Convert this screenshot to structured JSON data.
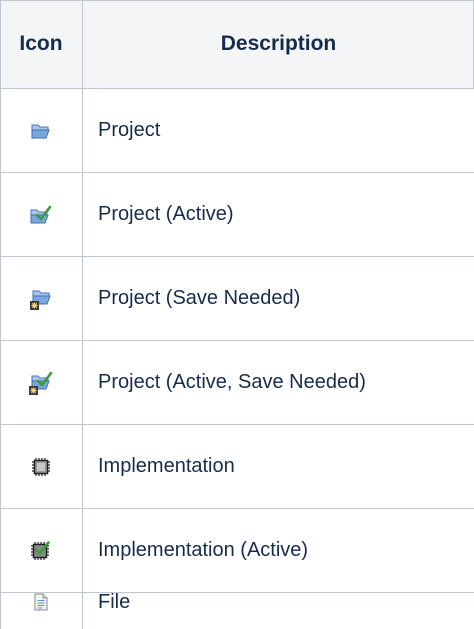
{
  "table": {
    "headers": {
      "icon": "Icon",
      "description": "Description"
    },
    "rows": [
      {
        "icon": "folder-open-icon",
        "label": "Project"
      },
      {
        "icon": "folder-open-active-icon",
        "label": "Project (Active)"
      },
      {
        "icon": "folder-open-save-needed-icon",
        "label": "Project (Save Needed)"
      },
      {
        "icon": "folder-open-active-save-needed-icon",
        "label": "Project (Active, Save Needed)"
      },
      {
        "icon": "chip-icon",
        "label": "Implementation"
      },
      {
        "icon": "chip-active-icon",
        "label": "Implementation (Active)"
      },
      {
        "icon": "file-icon",
        "label": "File"
      }
    ]
  },
  "colors": {
    "border": "#c1c7d0",
    "header_bg": "#f4f5f7",
    "text": "#172b4d",
    "folder_blue": "#6f9fd8",
    "check_green": "#3c9a3c"
  }
}
